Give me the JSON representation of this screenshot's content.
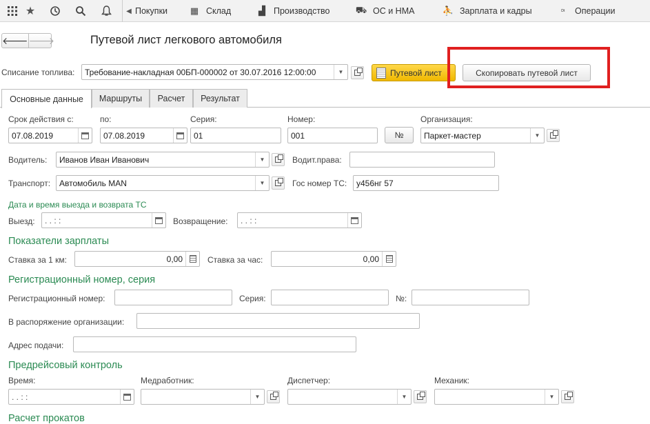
{
  "topbar": {
    "icons": [
      "apps-grid-icon",
      "star-icon",
      "history-icon",
      "search-icon",
      "bell-icon"
    ],
    "sections": [
      {
        "label": "Покупки",
        "icon": ""
      },
      {
        "label": "Склад",
        "icon": "▦"
      },
      {
        "label": "Производство",
        "icon": "▟"
      },
      {
        "label": "ОС и НМА",
        "icon": "⛟"
      },
      {
        "label": "Зарплата и кадры",
        "icon": "⛹"
      },
      {
        "label": "Операции",
        "icon": "ᴰᵗ"
      }
    ]
  },
  "nav": {
    "back": "🡐",
    "forward": "🡒"
  },
  "title": "Путевой лист легкового автомобиля",
  "fuel": {
    "label": "Списание топлива:",
    "value": "Требование-накладная 00БП-000002 от 30.07.2016 12:00:00"
  },
  "buttons": {
    "waybill": "Путевой лист",
    "copy": "Скопировать путевой лист",
    "number": "№"
  },
  "tabs": [
    "Основные данные",
    "Маршруты",
    "Расчет",
    "Результат"
  ],
  "main": {
    "valid_from_label": "Срок действия с:",
    "valid_from": "07.08.2019",
    "to_label": "по:",
    "to": "07.08.2019",
    "series_label": "Серия:",
    "series": "01",
    "number_label": "Номер:",
    "number": "001",
    "org_label": "Организация:",
    "org": "Паркет-мастер",
    "driver_label": "Водитель:",
    "driver": "Иванов Иван Иванович",
    "license_label": "Водит.права:",
    "license": "",
    "transport_label": "Транспорт:",
    "transport": "Автомобиль MAN",
    "plate_label": "Гос номер ТС:",
    "plate": "у456нг 57"
  },
  "departure": {
    "section": "Дата и время выезда и возврата ТС",
    "depart_label": "Выезд:",
    "depart": " .   .        :   :",
    "return_label": "Возвращение:",
    "return": " .   .        :   :"
  },
  "salary": {
    "section": "Показатели зарплаты",
    "per_km_label": "Ставка за 1 км:",
    "per_km": "0,00",
    "per_hour_label": "Ставка за час:",
    "per_hour": "0,00"
  },
  "registration": {
    "section": "Регистрационный номер, серия",
    "reg_no_label": "Регистрационный номер:",
    "series_label": "Серия:",
    "no_label": "№:",
    "org_disposal_label": "В распоряжение организации:",
    "address_label": "Адрес подачи:"
  },
  "control": {
    "section": "Предрейсовый контроль",
    "time_label": "Время:",
    "time": " .   .        :   :",
    "medic_label": "Медработник:",
    "dispatcher_label": "Диспетчер:",
    "mechanic_label": "Механик:"
  },
  "cut_section": "Расчет прокатов"
}
